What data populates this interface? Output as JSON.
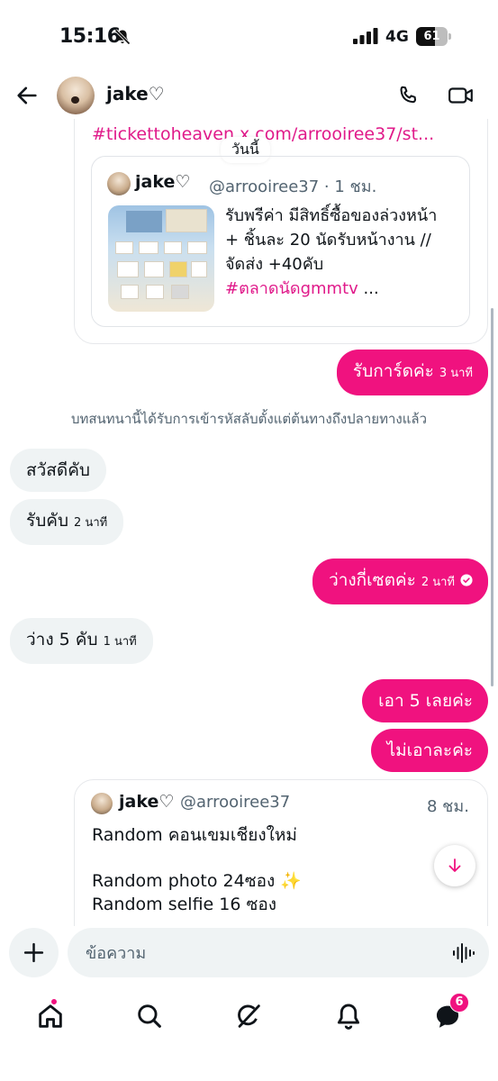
{
  "status_bar": {
    "time": "15:16",
    "network": "4G",
    "battery_level": "61",
    "battery_fraction": 0.61
  },
  "header": {
    "contact_name": "jake♡"
  },
  "top_card": {
    "partial_link": "#tickettoheaven x.com/arrooiree37/st...",
    "date_chip": "วันนี้",
    "quote": {
      "author_name": "jake♡",
      "author_meta": "@arrooiree37 · 1 ชม.",
      "text_lines": [
        "รับพรีค่า มีสิทธิ์ซื้อของล่วงหน้า",
        "+ ชิ้นละ 20 นัดรับหน้างาน //",
        "จัดส่ง +40คับ"
      ],
      "hashtag": "#ตลาดนัดgmmtv",
      "ellipsis": " ..."
    }
  },
  "messages": [
    {
      "direction": "out",
      "text": "รับการ์ดค่ะ",
      "time": "3 นาที"
    },
    {
      "direction": "notice",
      "text": "บทสนทนานี้ได้รับการเข้ารหัสลับตั้งแต่ต้นทางถึงปลายทางแล้ว"
    },
    {
      "direction": "in",
      "text": "สวัสดีคับ",
      "time": ""
    },
    {
      "direction": "in",
      "text": "รับคับ",
      "time": "2 นาที"
    },
    {
      "direction": "out",
      "text": "ว่างกี่เซตค่ะ",
      "time": "2 นาที",
      "read": true
    },
    {
      "direction": "in",
      "text": "ว่าง 5 คับ",
      "time": "1 นาที"
    },
    {
      "direction": "out",
      "text": "เอา 5 เลยค่ะ",
      "time": ""
    },
    {
      "direction": "out",
      "text": "ไม่เอาละค่ะ",
      "time": ""
    }
  ],
  "bottom_card": {
    "author_name": "jake♡",
    "author_handle": "@arrooiree37",
    "time": "8 ชม.",
    "lines": [
      "Random คอนเขมเชียงใหม่",
      "Random photo 24ซอง ✨",
      "Random selfie 16 ซอง"
    ]
  },
  "composer": {
    "placeholder": "ข้อความ"
  },
  "tabs": {
    "messages_badge": "6"
  },
  "colors": {
    "accent": "#f0127f",
    "link": "#e01a8a",
    "bubble_in": "#eff3f4"
  }
}
